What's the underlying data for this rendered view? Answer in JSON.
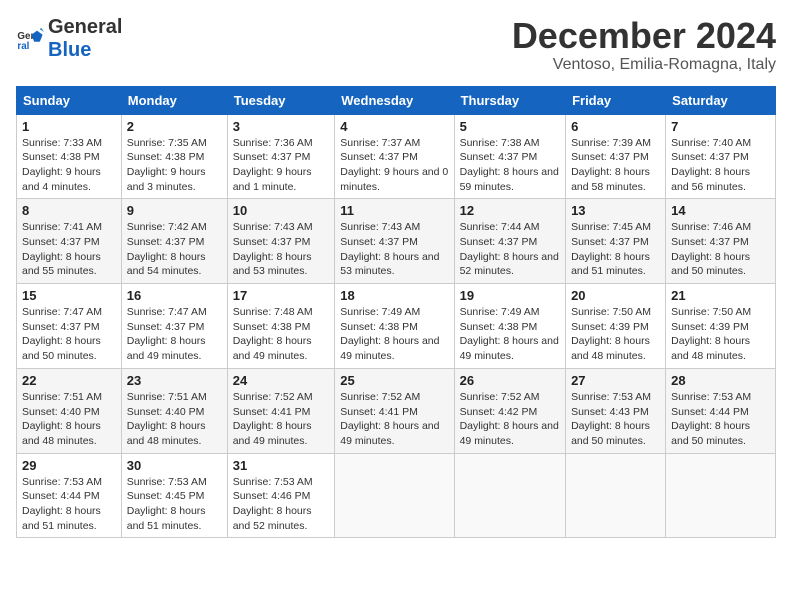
{
  "logo": {
    "general": "General",
    "blue": "Blue"
  },
  "title": "December 2024",
  "subtitle": "Ventoso, Emilia-Romagna, Italy",
  "columns": [
    "Sunday",
    "Monday",
    "Tuesday",
    "Wednesday",
    "Thursday",
    "Friday",
    "Saturday"
  ],
  "weeks": [
    [
      {
        "day": "1",
        "sunrise": "7:33 AM",
        "sunset": "4:38 PM",
        "daylight": "9 hours and 4 minutes."
      },
      {
        "day": "2",
        "sunrise": "7:35 AM",
        "sunset": "4:38 PM",
        "daylight": "9 hours and 3 minutes."
      },
      {
        "day": "3",
        "sunrise": "7:36 AM",
        "sunset": "4:37 PM",
        "daylight": "9 hours and 1 minute."
      },
      {
        "day": "4",
        "sunrise": "7:37 AM",
        "sunset": "4:37 PM",
        "daylight": "9 hours and 0 minutes."
      },
      {
        "day": "5",
        "sunrise": "7:38 AM",
        "sunset": "4:37 PM",
        "daylight": "8 hours and 59 minutes."
      },
      {
        "day": "6",
        "sunrise": "7:39 AM",
        "sunset": "4:37 PM",
        "daylight": "8 hours and 58 minutes."
      },
      {
        "day": "7",
        "sunrise": "7:40 AM",
        "sunset": "4:37 PM",
        "daylight": "8 hours and 56 minutes."
      }
    ],
    [
      {
        "day": "8",
        "sunrise": "7:41 AM",
        "sunset": "4:37 PM",
        "daylight": "8 hours and 55 minutes."
      },
      {
        "day": "9",
        "sunrise": "7:42 AM",
        "sunset": "4:37 PM",
        "daylight": "8 hours and 54 minutes."
      },
      {
        "day": "10",
        "sunrise": "7:43 AM",
        "sunset": "4:37 PM",
        "daylight": "8 hours and 53 minutes."
      },
      {
        "day": "11",
        "sunrise": "7:43 AM",
        "sunset": "4:37 PM",
        "daylight": "8 hours and 53 minutes."
      },
      {
        "day": "12",
        "sunrise": "7:44 AM",
        "sunset": "4:37 PM",
        "daylight": "8 hours and 52 minutes."
      },
      {
        "day": "13",
        "sunrise": "7:45 AM",
        "sunset": "4:37 PM",
        "daylight": "8 hours and 51 minutes."
      },
      {
        "day": "14",
        "sunrise": "7:46 AM",
        "sunset": "4:37 PM",
        "daylight": "8 hours and 50 minutes."
      }
    ],
    [
      {
        "day": "15",
        "sunrise": "7:47 AM",
        "sunset": "4:37 PM",
        "daylight": "8 hours and 50 minutes."
      },
      {
        "day": "16",
        "sunrise": "7:47 AM",
        "sunset": "4:37 PM",
        "daylight": "8 hours and 49 minutes."
      },
      {
        "day": "17",
        "sunrise": "7:48 AM",
        "sunset": "4:38 PM",
        "daylight": "8 hours and 49 minutes."
      },
      {
        "day": "18",
        "sunrise": "7:49 AM",
        "sunset": "4:38 PM",
        "daylight": "8 hours and 49 minutes."
      },
      {
        "day": "19",
        "sunrise": "7:49 AM",
        "sunset": "4:38 PM",
        "daylight": "8 hours and 49 minutes."
      },
      {
        "day": "20",
        "sunrise": "7:50 AM",
        "sunset": "4:39 PM",
        "daylight": "8 hours and 48 minutes."
      },
      {
        "day": "21",
        "sunrise": "7:50 AM",
        "sunset": "4:39 PM",
        "daylight": "8 hours and 48 minutes."
      }
    ],
    [
      {
        "day": "22",
        "sunrise": "7:51 AM",
        "sunset": "4:40 PM",
        "daylight": "8 hours and 48 minutes."
      },
      {
        "day": "23",
        "sunrise": "7:51 AM",
        "sunset": "4:40 PM",
        "daylight": "8 hours and 48 minutes."
      },
      {
        "day": "24",
        "sunrise": "7:52 AM",
        "sunset": "4:41 PM",
        "daylight": "8 hours and 49 minutes."
      },
      {
        "day": "25",
        "sunrise": "7:52 AM",
        "sunset": "4:41 PM",
        "daylight": "8 hours and 49 minutes."
      },
      {
        "day": "26",
        "sunrise": "7:52 AM",
        "sunset": "4:42 PM",
        "daylight": "8 hours and 49 minutes."
      },
      {
        "day": "27",
        "sunrise": "7:53 AM",
        "sunset": "4:43 PM",
        "daylight": "8 hours and 50 minutes."
      },
      {
        "day": "28",
        "sunrise": "7:53 AM",
        "sunset": "4:44 PM",
        "daylight": "8 hours and 50 minutes."
      }
    ],
    [
      {
        "day": "29",
        "sunrise": "7:53 AM",
        "sunset": "4:44 PM",
        "daylight": "8 hours and 51 minutes."
      },
      {
        "day": "30",
        "sunrise": "7:53 AM",
        "sunset": "4:45 PM",
        "daylight": "8 hours and 51 minutes."
      },
      {
        "day": "31",
        "sunrise": "7:53 AM",
        "sunset": "4:46 PM",
        "daylight": "8 hours and 52 minutes."
      },
      null,
      null,
      null,
      null
    ]
  ]
}
